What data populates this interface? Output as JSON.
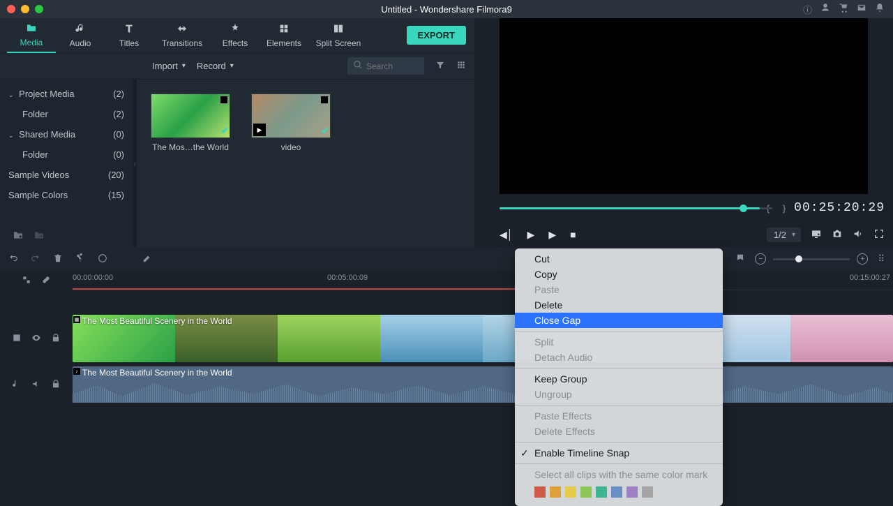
{
  "titlebar": {
    "title": "Untitled - Wondershare Filmora9"
  },
  "tabs": {
    "media": "Media",
    "audio": "Audio",
    "titles": "Titles",
    "transitions": "Transitions",
    "effects": "Effects",
    "elements": "Elements",
    "split": "Split Screen"
  },
  "export": "EXPORT",
  "toolbar": {
    "import": "Import",
    "record": "Record",
    "search_ph": "Search"
  },
  "sidebar": {
    "project_media": {
      "label": "Project Media",
      "count": "(2)"
    },
    "folder1": {
      "label": "Folder",
      "count": "(2)"
    },
    "shared_media": {
      "label": "Shared Media",
      "count": "(0)"
    },
    "folder2": {
      "label": "Folder",
      "count": "(0)"
    },
    "sample_videos": {
      "label": "Sample Videos",
      "count": "(20)"
    },
    "sample_colors": {
      "label": "Sample Colors",
      "count": "(15)"
    }
  },
  "media": {
    "item1": "The Mos…the World",
    "item2": "video"
  },
  "preview": {
    "timecode": "00:25:20:29",
    "ratio": "1/2"
  },
  "ruler": {
    "t0": "00:00:00:00",
    "t1": "00:05:00:09",
    "t2": "00:15:00:27"
  },
  "track": {
    "video_label": "The Most Beautiful Scenery in the World",
    "audio_label": "The Most Beautiful Scenery in the World"
  },
  "ctx": {
    "cut": "Cut",
    "copy": "Copy",
    "paste": "Paste",
    "delete": "Delete",
    "close_gap": "Close Gap",
    "split": "Split",
    "detach": "Detach Audio",
    "keep_group": "Keep Group",
    "ungroup": "Ungroup",
    "paste_fx": "Paste Effects",
    "delete_fx": "Delete Effects",
    "snap": "Enable Timeline Snap",
    "select_all": "Select all clips with the same color mark"
  }
}
